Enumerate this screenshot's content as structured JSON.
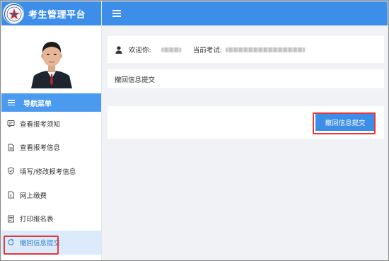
{
  "app": {
    "title": "考生管理平台",
    "logo_icon": "school-emblem-icon"
  },
  "colors": {
    "primary": "#3d8ee8",
    "nav_header": "#4a9bf0",
    "active_bg": "#dcebfb",
    "highlight": "#e23b3b"
  },
  "sidebar": {
    "nav_header": "导航菜单",
    "items": [
      {
        "label": "查看报考须知",
        "icon": "notice-icon"
      },
      {
        "label": "查看报考信息",
        "icon": "document-icon"
      },
      {
        "label": "填写/修改报考信息",
        "icon": "shield-check-icon"
      },
      {
        "label": "网上缴费",
        "icon": "payment-icon"
      },
      {
        "label": "打印报名表",
        "icon": "print-form-icon"
      },
      {
        "label": "撤回信息提交",
        "icon": "refresh-icon",
        "active": true
      }
    ]
  },
  "header": {
    "welcome_label": "欢迎你:",
    "exam_label": "当前考试:"
  },
  "main": {
    "section_title": "撤回信息提交",
    "submit_label": "撤回信息提交"
  }
}
